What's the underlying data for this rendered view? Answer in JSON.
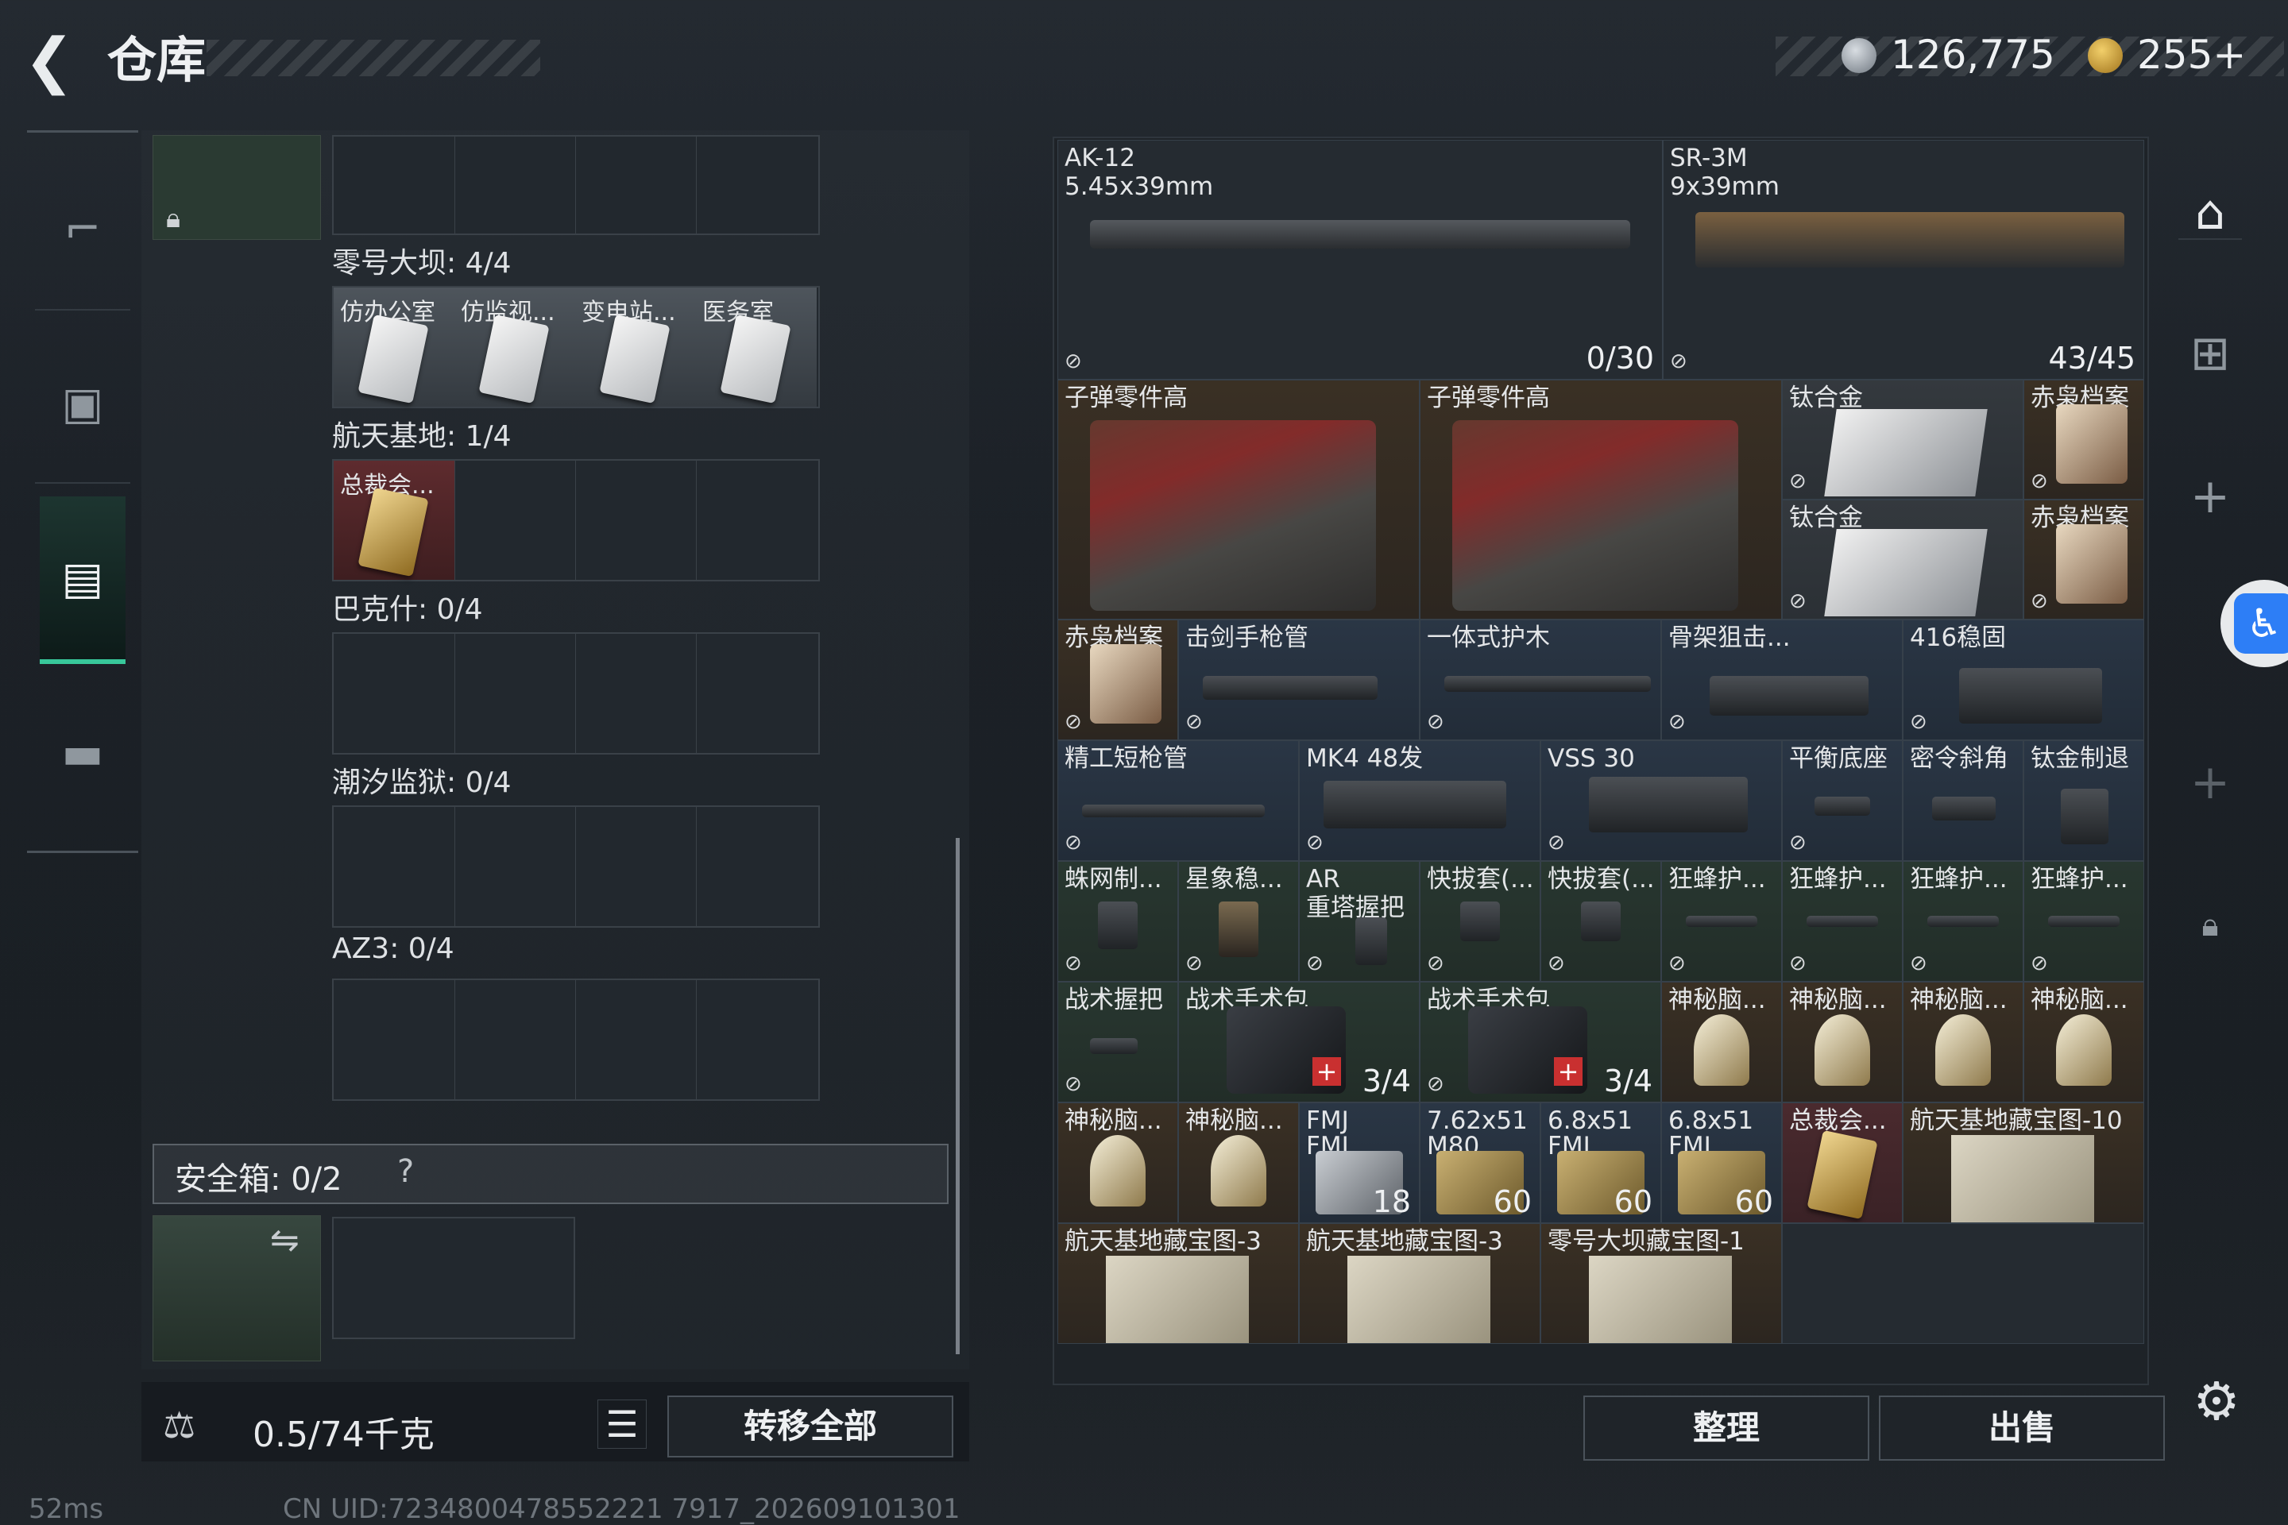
{
  "header": {
    "title": "仓库",
    "currency_silver": "126,775",
    "currency_gold": "255+",
    "plus": "+"
  },
  "sidebar": {
    "items": [
      {
        "name": "weapons",
        "icon": "pistol-icon"
      },
      {
        "name": "backpack",
        "icon": "backpack-icon"
      },
      {
        "name": "storage",
        "icon": "locker-icon",
        "active": true
      },
      {
        "name": "case",
        "icon": "briefcase-icon"
      }
    ]
  },
  "left": {
    "sections": [
      {
        "label": "零号大坝: 4/4",
        "slots": [
          "仿办公室",
          "仿监视...",
          "变电站...",
          "医务室"
        ]
      },
      {
        "label": "航天基地: 1/4",
        "slots": [
          "总裁会..."
        ]
      },
      {
        "label": "巴克什: 0/4",
        "slots": []
      },
      {
        "label": "潮汐监狱: 0/4",
        "slots": []
      },
      {
        "label": "AZ3: 0/4",
        "slots": []
      }
    ],
    "safe_box": {
      "label": "安全箱: 0/2",
      "help": "?"
    },
    "weight": "0.5/74千克",
    "list_icon": "list-icon",
    "transfer_all": "转移全部"
  },
  "status": {
    "ping": "52ms",
    "uid": "CN UID:7234800478552221 7917_202609101301"
  },
  "inventory": {
    "weapons": [
      {
        "name": "AK-12",
        "caliber": "5.45x39mm",
        "ammo": "0/30"
      },
      {
        "name": "SR-3M",
        "caliber": "9x39mm",
        "ammo": "43/45"
      }
    ],
    "row2": [
      "子弹零件高",
      "子弹零件高",
      "钛合金",
      "赤枭档案",
      "钛合金",
      "赤枭档案"
    ],
    "row3": [
      "赤枭档案",
      "击剑手枪管",
      "一体式护木",
      "骨架狙击...",
      "416稳固"
    ],
    "row4": [
      "精工短枪管",
      "MK4 48发",
      "VSS 30",
      "平衡底座",
      "密令斜角",
      "钛金制退"
    ],
    "row5": [
      "蛛网制...",
      "星象稳...",
      "AR\n重塔握把",
      "快拔套(...",
      "快拔套(...",
      "狂蜂护...",
      "狂蜂护...",
      "狂蜂护...",
      "狂蜂护..."
    ],
    "row6": [
      {
        "name": "战术握把"
      },
      {
        "name": "战术手术包",
        "count": "3/4"
      },
      {
        "name": "战术手术包",
        "count": "3/4"
      },
      {
        "name": "神秘脑..."
      },
      {
        "name": "神秘脑..."
      },
      {
        "name": "神秘脑..."
      },
      {
        "name": "神秘脑..."
      }
    ],
    "row7": [
      {
        "name": "神秘脑..."
      },
      {
        "name": "神秘脑..."
      },
      {
        "name": "FMJ",
        "sub": "FMJ",
        "count": "18"
      },
      {
        "name": "7.62x51",
        "sub": "M80",
        "count": "60"
      },
      {
        "name": "6.8x51",
        "sub": "FMJ",
        "count": "60"
      },
      {
        "name": "6.8x51",
        "sub": "FMJ",
        "count": "60"
      },
      {
        "name": "总裁会..."
      },
      {
        "name": "航天基地藏宝图-10"
      }
    ],
    "row8": [
      "航天基地藏宝图-3",
      "航天基地藏宝图-3",
      "零号大坝藏宝图-1"
    ]
  },
  "actions": {
    "organize": "整理",
    "sell": "出售"
  },
  "colors": {
    "accent": "#38c79a",
    "access_blue": "#2d7ef6"
  }
}
